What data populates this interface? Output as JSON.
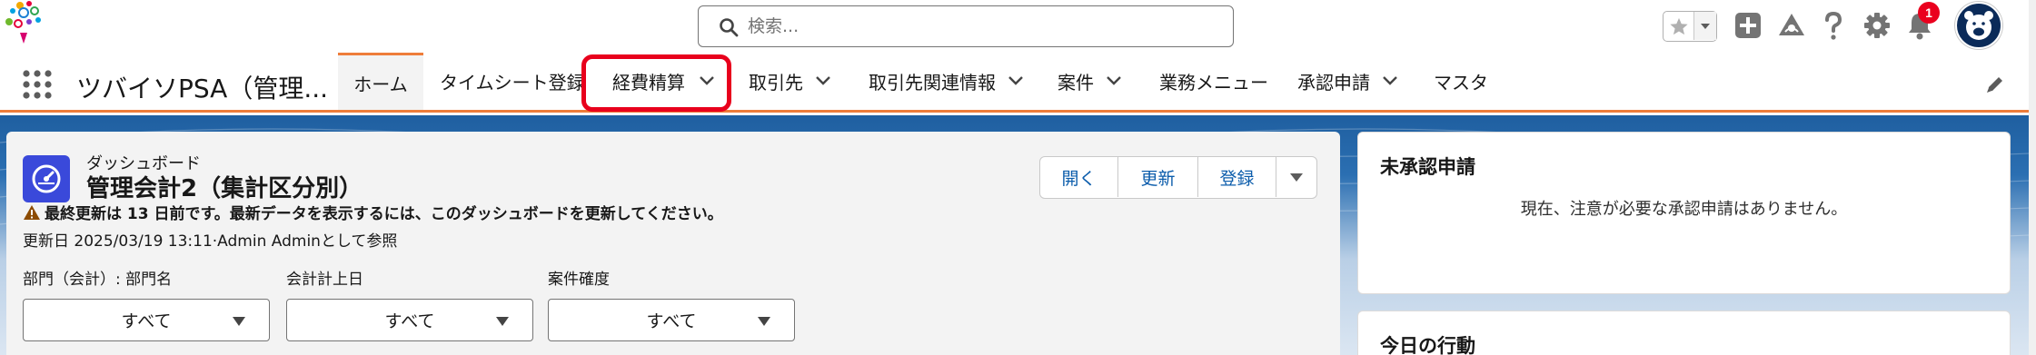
{
  "search": {
    "placeholder": "検索..."
  },
  "header": {
    "notification_count": "1"
  },
  "nav": {
    "app_name": "ツバイソPSA（管理...",
    "items": [
      {
        "label": "ホーム"
      },
      {
        "label": "タイムシート登録"
      },
      {
        "label": "経費精算"
      },
      {
        "label": "取引先"
      },
      {
        "label": "取引先関連情報"
      },
      {
        "label": "案件"
      },
      {
        "label": "業務メニュー"
      },
      {
        "label": "承認申請"
      },
      {
        "label": "マスタ"
      }
    ]
  },
  "dashboard": {
    "type_label": "ダッシュボード",
    "title": "管理会計2（集計区分別）",
    "warning": "最終更新は 13 日前です。最新データを表示するには、このダッシュボードを更新してください。",
    "updated": "更新日 2025/03/19 13:11·Admin Adminとして参照",
    "buttons": {
      "open": "開く",
      "refresh": "更新",
      "register": "登録"
    },
    "filters": [
      {
        "label": "部門（会計）: 部門名",
        "value": "すべて"
      },
      {
        "label": "会計計上日",
        "value": "すべて"
      },
      {
        "label": "案件確度",
        "value": "すべて"
      }
    ]
  },
  "approvals": {
    "title": "未承認申請",
    "empty_message": "現在、注意が必要な承認申請はありません。"
  },
  "today": {
    "title": "今日の行動"
  },
  "colors": {
    "accent": "#ee7d3a",
    "link": "#0b5cab",
    "highlight": "#e8001c",
    "dashboard_icon": "#3a49da"
  }
}
